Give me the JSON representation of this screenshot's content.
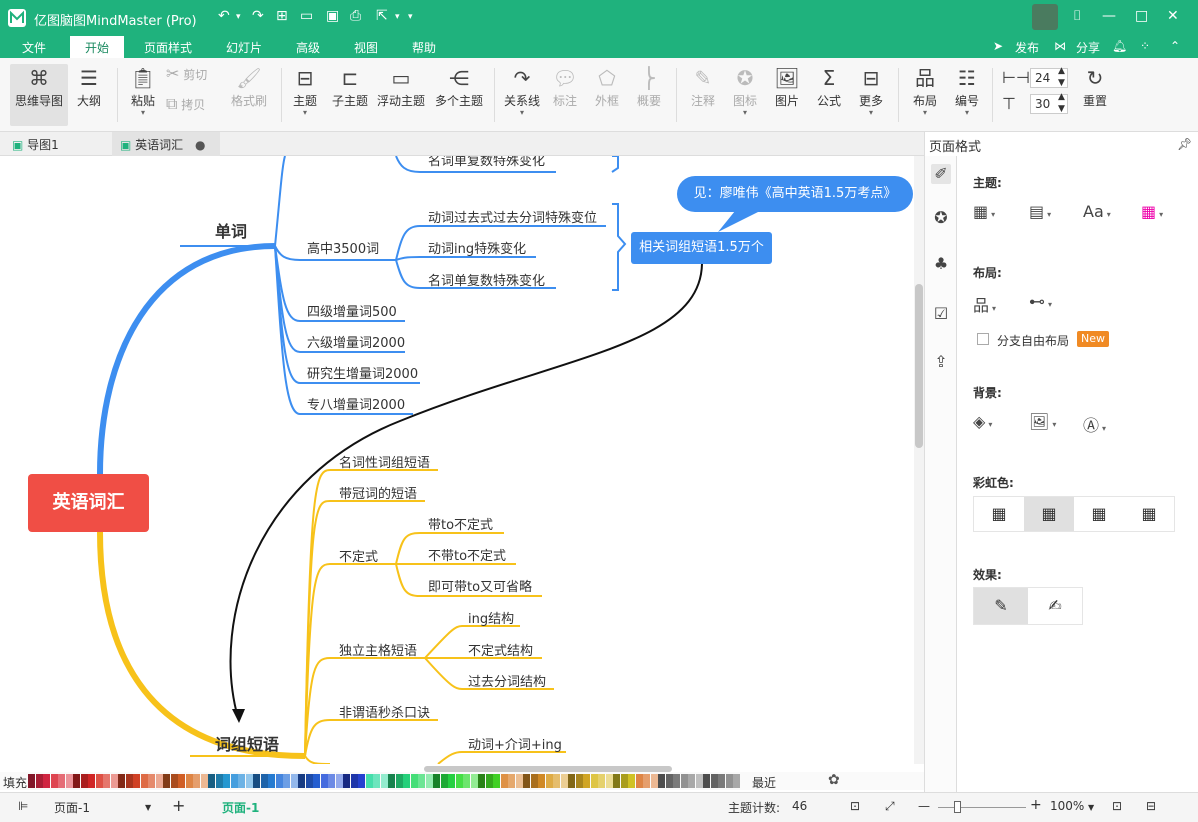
{
  "app": {
    "title": "亿图脑图MindMaster (Pro)"
  },
  "titlebar": {
    "quick_actions": [
      "↶",
      "↷",
      "⊞",
      "📂",
      "💾",
      "🖨",
      "↗"
    ]
  },
  "menu": {
    "items": [
      "文件",
      "开始",
      "页面样式",
      "幻灯片",
      "高级",
      "视图",
      "帮助"
    ],
    "active": "开始",
    "right": {
      "publish": "发布",
      "share": "分享"
    }
  },
  "ribbon": {
    "mindmap": "思维导图",
    "outline": "大纲",
    "paste": "粘贴",
    "cut": "剪切",
    "copy": "拷贝",
    "format_painter": "格式刷",
    "topic": "主题",
    "subtopic": "子主题",
    "floating": "浮动主题",
    "multiple": "多个主题",
    "relation": "关系线",
    "callout": "标注",
    "boundary": "外框",
    "summary": "概要",
    "note": "注释",
    "icon": "图标",
    "image": "图片",
    "formula": "公式",
    "more": "更多",
    "layout": "布局",
    "numbering": "编号",
    "spacing_h": "24",
    "spacing_v": "30",
    "reset": "重置"
  },
  "tabs": [
    {
      "label": "导图1"
    },
    {
      "label": "英语词汇"
    }
  ],
  "mindmap": {
    "root": "英语词汇",
    "callout": "见：廖唯伟《高中英语1.5万考点》",
    "floating": "相关词组短语1.5万个",
    "words": {
      "label": "单词",
      "top_partial": "名词单复数特殊变化",
      "high": "高中3500词",
      "high_children": [
        "动词过去式过去分词特殊变位",
        "动词ing特殊变化",
        "名词单复数特殊变化"
      ],
      "others": [
        "四级增量词500",
        "六级增量词2000",
        "研究生增量词2000",
        "专八增量词2000"
      ]
    },
    "phrases": {
      "label": "词组短语",
      "items": {
        "noun": "名词性词组短语",
        "article": "带冠词的短语",
        "infinitive": "不定式",
        "infinitive_children": [
          "带to不定式",
          "不带to不定式",
          "即可带to又可省略"
        ],
        "absolute": "独立主格短语",
        "absolute_children": [
          "ing结构",
          "不定式结构",
          "过去分词结构"
        ],
        "nonfinite": "非谓语秒杀口诀",
        "verb_prep": "动词+介词+ing"
      }
    }
  },
  "palette": {
    "label": "填充",
    "recent": "最近"
  },
  "status": {
    "page_dropdown": "页面-1",
    "page_tab": "页面-1",
    "topic_count_label": "主题计数:",
    "topic_count": "46",
    "zoom": "100%"
  },
  "panel": {
    "title": "页面格式",
    "theme": "主题:",
    "layout": "布局:",
    "free_layout": "分支自由布局",
    "new": "New",
    "background": "背景:",
    "rainbow": "彩虹色:",
    "effect": "效果:"
  },
  "colors": {
    "brand": "#1fb27d",
    "root": "#f04e45",
    "words_branch": "#3d8ef0",
    "phrases_branch": "#f7c21a"
  }
}
